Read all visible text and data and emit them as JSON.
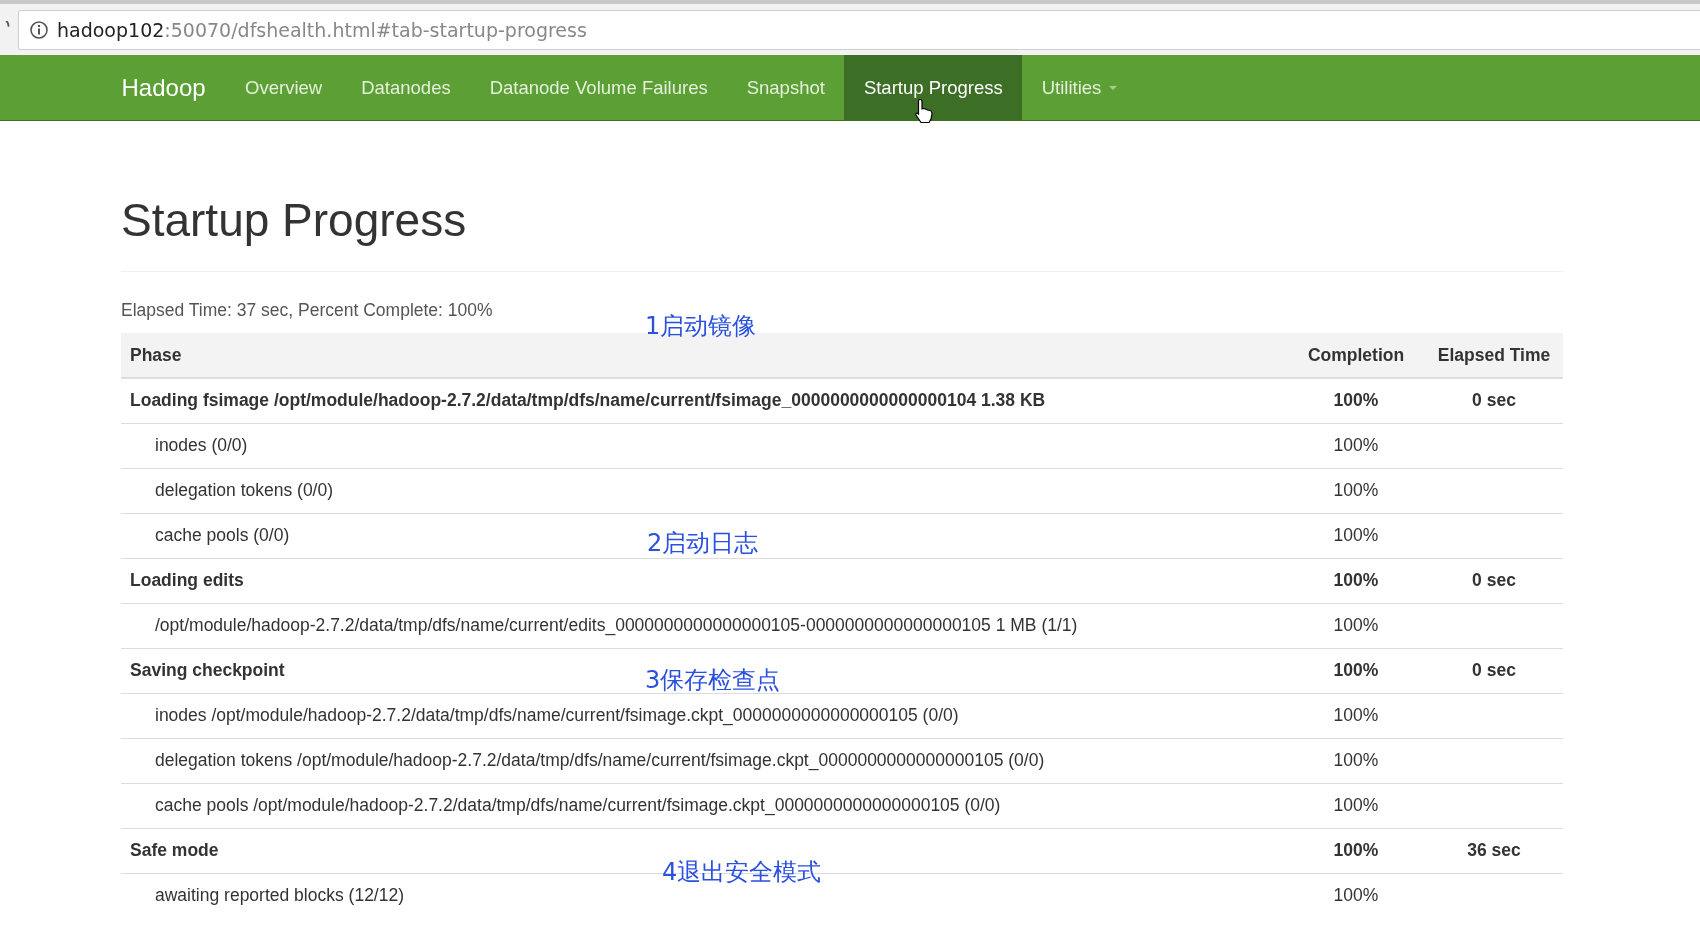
{
  "address_bar": {
    "host": "hadoop102",
    "path": ":50070/dfshealth.html#tab-startup-progress"
  },
  "navbar": {
    "brand": "Hadoop",
    "items": [
      {
        "label": "Overview",
        "selected": false,
        "kind": "link"
      },
      {
        "label": "Datanodes",
        "selected": false,
        "kind": "link"
      },
      {
        "label": "Datanode Volume Failures",
        "selected": false,
        "kind": "link"
      },
      {
        "label": "Snapshot",
        "selected": false,
        "kind": "link"
      },
      {
        "label": "Startup Progress",
        "selected": true,
        "kind": "link"
      },
      {
        "label": "Utilities",
        "selected": false,
        "kind": "dropdown"
      }
    ]
  },
  "page": {
    "title": "Startup Progress",
    "summary": "Elapsed Time: 37 sec, Percent Complete: 100%"
  },
  "table": {
    "columns": [
      "Phase",
      "Completion",
      "Elapsed Time"
    ],
    "rows": [
      {
        "kind": "phase",
        "name": "Loading fsimage /opt/module/hadoop-2.7.2/data/tmp/dfs/name/current/fsimage_0000000000000000104 1.38 KB",
        "completion": "100%",
        "elapsed": "0 sec"
      },
      {
        "kind": "step",
        "name": "inodes (0/0)",
        "completion": "100%"
      },
      {
        "kind": "step",
        "name": "delegation tokens (0/0)",
        "completion": "100%"
      },
      {
        "kind": "step",
        "name": "cache pools (0/0)",
        "completion": "100%"
      },
      {
        "kind": "phase",
        "name": "Loading edits",
        "completion": "100%",
        "elapsed": "0 sec"
      },
      {
        "kind": "step",
        "name": "/opt/module/hadoop-2.7.2/data/tmp/dfs/name/current/edits_0000000000000000105-0000000000000000105 1 MB (1/1)",
        "completion": "100%"
      },
      {
        "kind": "phase",
        "name": "Saving checkpoint",
        "completion": "100%",
        "elapsed": "0 sec"
      },
      {
        "kind": "step",
        "name": "inodes /opt/module/hadoop-2.7.2/data/tmp/dfs/name/current/fsimage.ckpt_0000000000000000105 (0/0)",
        "completion": "100%"
      },
      {
        "kind": "step",
        "name": "delegation tokens /opt/module/hadoop-2.7.2/data/tmp/dfs/name/current/fsimage.ckpt_0000000000000000105 (0/0)",
        "completion": "100%"
      },
      {
        "kind": "step",
        "name": "cache pools /opt/module/hadoop-2.7.2/data/tmp/dfs/name/current/fsimage.ckpt_0000000000000000105 (0/0)",
        "completion": "100%"
      },
      {
        "kind": "phase",
        "name": "Safe mode",
        "completion": "100%",
        "elapsed": "36 sec"
      },
      {
        "kind": "step",
        "name": "awaiting reported blocks (12/12)",
        "completion": "100%"
      }
    ]
  },
  "annotations": [
    "1启动镜像",
    "2启动日志",
    "3保存检查点",
    "4退出安全模式"
  ]
}
